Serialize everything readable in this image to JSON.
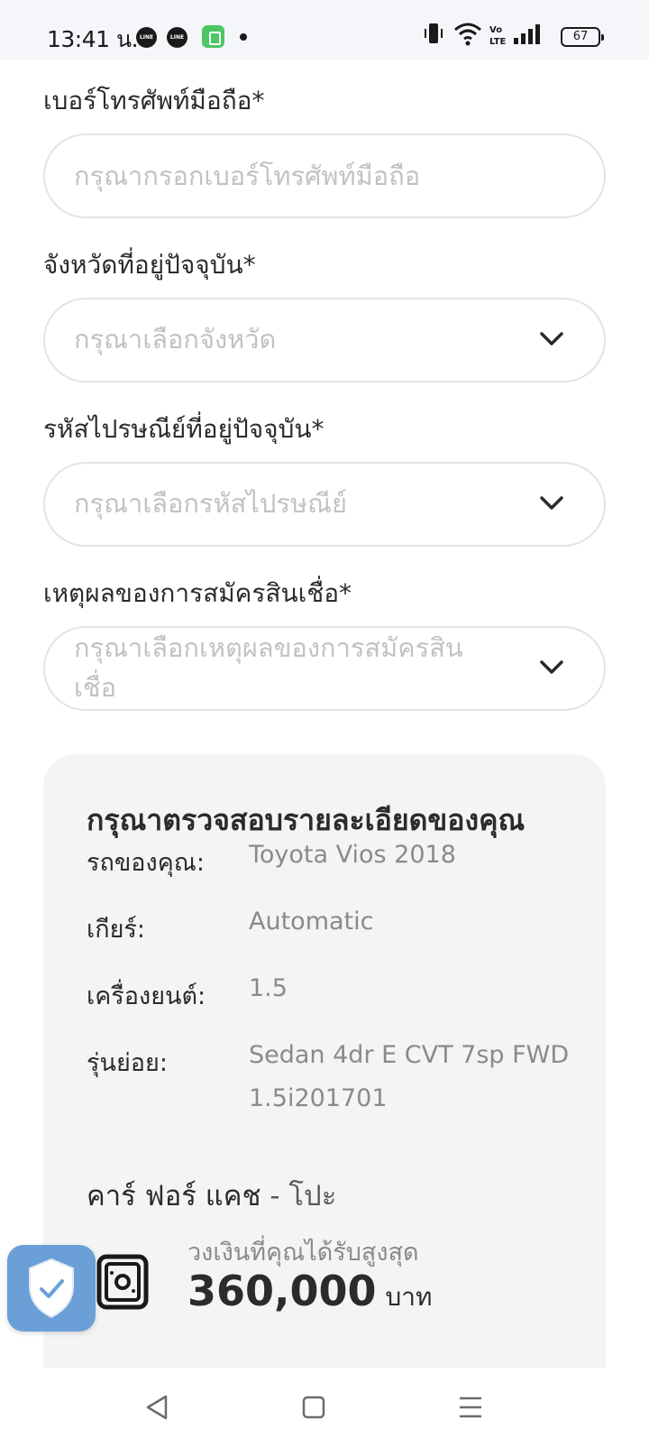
{
  "status_bar": {
    "time": "13:41 น.",
    "notifications": [
      "LINE",
      "LINE"
    ],
    "battery": "67"
  },
  "form": {
    "phone": {
      "label": "เบอร์โทรศัพท์มือถือ*",
      "placeholder": "กรุณากรอกเบอร์โทรศัพท์มือถือ",
      "value": ""
    },
    "province": {
      "label": "จังหวัดที่อยู่ปัจจุบัน*",
      "placeholder": "กรุณาเลือกจังหวัด"
    },
    "postcode": {
      "label": "รหัสไปรษณีย์ที่อยู่ปัจจุบัน*",
      "placeholder": "กรุณาเลือกรหัสไปรษณีย์"
    },
    "reason": {
      "label": "เหตุผลของการสมัครสินเชื่อ*",
      "placeholder_line1": "กรุณาเลือกเหตุผลของการสมัครสิน",
      "placeholder_line2": "เชื่อ"
    }
  },
  "summary": {
    "title": "กรุณาตรวจสอบรายละเอียดของคุณ",
    "rows": [
      {
        "label": "รถของคุณ:",
        "value": "Toyota Vios 2018"
      },
      {
        "label": "เกียร์:",
        "value": "Automatic"
      },
      {
        "label": "เครื่องยนต์:",
        "value": "1.5"
      },
      {
        "label": "รุ่นย่อย:",
        "value": "Sedan 4dr E CVT 7sp FWD 1.5i201701"
      }
    ],
    "product_name": "คาร์ ฟอร์ แคช",
    "product_tag": "- โปะ",
    "amount_caption": "วงเงินที่คุณได้รับสูงสุด",
    "amount": "360,000",
    "amount_unit": "บาท"
  },
  "icons": {
    "shield": "shield-check-icon",
    "cash": "cash-icon",
    "nav": [
      "back-icon",
      "home-icon",
      "menu-icon"
    ]
  },
  "colors": {
    "shield_bg": "#6a9fd8",
    "card_bg": "#f4f4f4",
    "placeholder": "#c2c2c2"
  }
}
